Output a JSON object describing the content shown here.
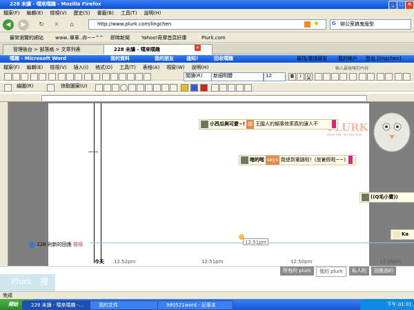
{
  "firefox": {
    "title": "228 未讀 - 噗來噗趣 - Mozilla Firefox",
    "menu": [
      "檔案(F)",
      "編輯(E)",
      "檢視(V)",
      "歷史(S)",
      "書籤(B)",
      "工具(T)",
      "說明(H)"
    ],
    "url": "http://www.plurk.com/lingchen",
    "search_value": "辦公室搞鬼版型",
    "bookmarks": [
      "最常瀏覽的網站",
      "www..單車..你~~^^",
      "即時新聞",
      "Yahoo!奇摩首頁好康",
      "Plurk.com"
    ],
    "tabs": [
      "管理後台 > 部落格 > 文章列表",
      "228 未讀 - 噗來噗趣"
    ]
  },
  "word": {
    "title": "噗趣 - Microsoft Word",
    "menu": [
      "檔案(F)",
      "編輯(E)",
      "檢視(V)",
      "插入(I)",
      "格式(O)",
      "工具(T)",
      "表格(A)",
      "視窗(W)",
      "說明(H)"
    ],
    "font_name": "新細明體",
    "font_size": "12",
    "zoom": "閱讀(R)",
    "draw_label": "繪圖(R)",
    "autoshape_label": "快取圖案(U)"
  },
  "plurk": {
    "nav_items": [
      "我的資料",
      "我的朋友",
      "通知!",
      "回收噗趣"
    ],
    "nav_right": [
      "尋找/邀請朋友",
      "我的帳戶",
      "登出 [lingchen]"
    ],
    "search_placeholder": "輸入最後噗的內容",
    "logo": "PLURK",
    "slogan": "your life, on the line",
    "messages": [
      {
        "nick": "小西瓜與可愛~!",
        "qual": "說",
        "text": "王國人的蝴事效率真的讓人不"
      },
      {
        "nick": "暗的啦",
        "qual": "says",
        "text": "我總到電腦啦！(放暑假啦~~)"
      },
      {
        "nick": "((Q毛小寶))",
        "qual": "",
        "text": ""
      },
      {
        "nick": "Ka",
        "qual": "",
        "text": ""
      }
    ],
    "marker_time": "12:51pm",
    "unread_text": "228 則新的回應",
    "unread_link": "檢視",
    "time_labels": [
      "今天",
      "12:52pm",
      "12:51pm",
      "12:50pm",
      "12:49pm"
    ],
    "filter_tabs": [
      "所有的 plurk",
      "我的 plurk",
      "私人的",
      "回應過的"
    ],
    "footer_logo": "Plurk",
    "footer_char": "搜"
  },
  "status": "完成",
  "taskbar": {
    "start": "開始",
    "tasks": [
      "228 未讀 - 噗來噗趣 -...",
      "我的文件",
      "980521word - 記事本"
    ],
    "clock": "下午 01:01"
  }
}
